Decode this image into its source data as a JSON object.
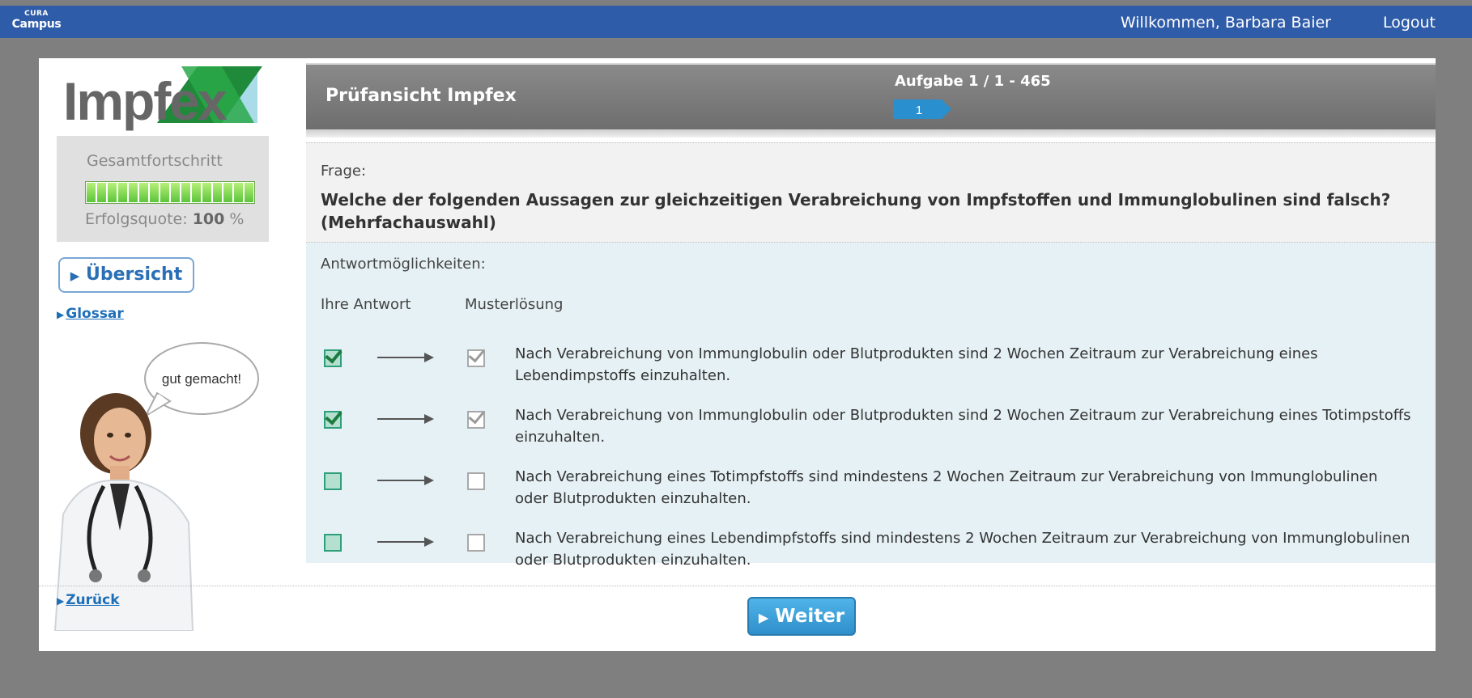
{
  "topbar": {
    "brand_top": "CURA",
    "brand_bottom": "Campus",
    "welcome": "Willkommen, Barbara Baier",
    "logout": "Logout"
  },
  "sidebar": {
    "logo_text": "Impfex",
    "progress_label": "Gesamtfortschritt",
    "progress_value": 1.0,
    "rate_label": "Erfolgsquote:",
    "rate_value": "100",
    "rate_unit": "%",
    "overview_button": "Übersicht",
    "glossary_link": "Glossar",
    "speech_bubble": "gut gemacht!",
    "back_link": "Zurück"
  },
  "header": {
    "title": "Prüfansicht Impfex",
    "task_label": "Aufgabe 1 / 1 - 465",
    "task_number": "1"
  },
  "question": {
    "label": "Frage:",
    "text": "Welche der folgenden Aussagen zur gleichzeitigen Verabreichung von Impfstoffen und Immunglobulinen sind falsch? (Mehrfachauswahl)"
  },
  "answers": {
    "label": "Antwortmöglichkeiten:",
    "col_your_answer": "Ihre Antwort",
    "col_solution": "Musterlösung",
    "items": [
      {
        "text": "Nach Verabreichung von Immunglobulin oder Blutprodukten sind 2 Wochen Zeitraum zur Verabreichung eines Lebendimpstoffs einzuhalten.",
        "your_answer": true,
        "solution": true
      },
      {
        "text": "Nach Verabreichung von Immunglobulin oder Blutprodukten sind 2 Wochen Zeitraum zur Verabreichung eines Totimpstoffs einzuhalten.",
        "your_answer": true,
        "solution": true
      },
      {
        "text": "Nach Verabreichung eines Totimpfstoffs sind mindestens 2 Wochen Zeitraum zur Verabreichung von Immunglobulinen oder Blutprodukten einzuhalten.",
        "your_answer": false,
        "solution": false
      },
      {
        "text": "Nach Verabreichung eines Lebendimpfstoffs sind mindestens 2 Wochen Zeitraum zur Verabreichung von Immunglobulinen oder Blutprodukten einzuhalten.",
        "your_answer": false,
        "solution": false
      }
    ]
  },
  "footer": {
    "next_button": "Weiter"
  },
  "colors": {
    "topbar": "#2f5ca8",
    "background": "#7f7f7f",
    "accent_blue": "#2f8fcb",
    "answer_bg": "#e6f1f5"
  }
}
